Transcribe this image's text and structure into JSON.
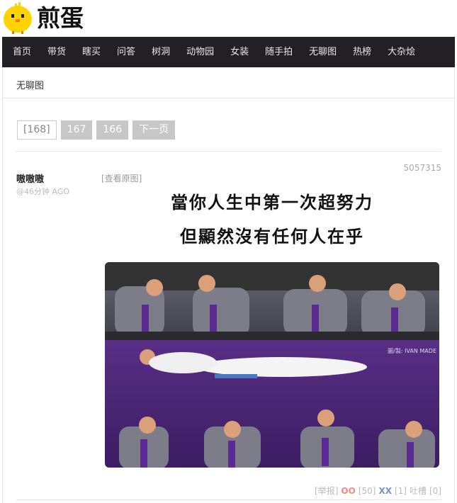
{
  "site": {
    "name": "煎蛋"
  },
  "nav": {
    "items": [
      "首页",
      "带货",
      "瞎买",
      "问答",
      "树洞",
      "动物园",
      "女装",
      "随手拍",
      "无聊图",
      "热榜",
      "大杂烩"
    ]
  },
  "breadcrumb": {
    "label": "无聊图"
  },
  "pager": {
    "current": "[168]",
    "pages": [
      "167",
      "166"
    ],
    "next": "下一页"
  },
  "post": {
    "id": "5057315",
    "author": "嗷嗷嗷",
    "time": "@46分钟 AGO",
    "view_original": "[查看原图]",
    "caption_line1": "當你人生中第一次超努力",
    "caption_line2": "但顯然沒有任何人在乎",
    "watermark": "圖/製: IVAN MADE",
    "report": "[举报]",
    "oo_label": "OO",
    "oo_count": "[50]",
    "xx_label": "XX",
    "xx_count": "[1]",
    "comment_label": "吐槽",
    "comment_count": "[0]"
  },
  "colors": {
    "nav_bg": "#221f25",
    "pager_bg": "#c7c7c7",
    "oo": "#f08a8a",
    "xx": "#7b8fd6",
    "gif_bg": "#4a2a6e"
  }
}
